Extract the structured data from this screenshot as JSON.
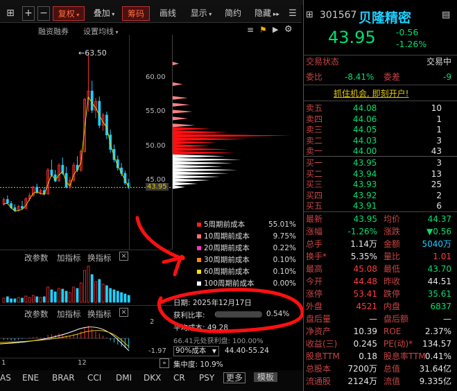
{
  "toolbar": {
    "fuquan": "复权",
    "diejia": "叠加",
    "chouma": "筹码",
    "huaxian": "画线",
    "xianshi": "显示",
    "jianyue": "简约",
    "yincang": "隐藏"
  },
  "chart": {
    "rongzi": "融资融券",
    "set_ma": "设置均线",
    "peak_label": "63.50",
    "y_ticks": [
      "60.00",
      "55.00",
      "50.00",
      "45.00"
    ],
    "current_price": "43.95",
    "panel2_params": "改参数",
    "panel2_add": "加指标",
    "panel2_switch": "换指标",
    "panel3_params": "改参数",
    "panel3_add": "加指标",
    "panel3_switch": "换指标",
    "macd_ticks": [
      "2",
      "-1.97"
    ],
    "x_ticks": [
      "1",
      "12"
    ]
  },
  "chip": {
    "legend": [
      {
        "label": "5周期前成本",
        "value": "55.01%",
        "color": "#ff2020"
      },
      {
        "label": "10周期前成本",
        "value": "9.75%",
        "color": "#ff7070"
      },
      {
        "label": "20周期前成本",
        "value": "0.22%",
        "color": "#ff30c0"
      },
      {
        "label": "30周期前成本",
        "value": "0.10%",
        "color": "#ff8a00"
      },
      {
        "label": "60周期前成本",
        "value": "0.10%",
        "color": "#ffe000"
      },
      {
        "label": "100周期前成本",
        "value": "0.00%",
        "color": "#ffffff"
      }
    ],
    "date_label": "日期: 2025年12月17日",
    "profit_label": "获利比率:",
    "profit_value": "0.54%",
    "profit_ratio": 0.54,
    "avg_cost": "平均成本: 49.28",
    "cost_line": "66.41元处获利盘: 100.00%",
    "cost90_select": "90%成本",
    "cost90_range": "44.40-55.24",
    "concentration": "集中度: 10.9%"
  },
  "bottom_tabs": [
    "AS",
    "ENE",
    "BRAR",
    "CCI",
    "DMI",
    "DKX",
    "CR",
    "PSY",
    "更多",
    "模板"
  ],
  "quote": {
    "code": "301567",
    "name": "贝隆精密",
    "price": "43.95",
    "change": "-0.56",
    "change_pct": "-1.26%",
    "status_label": "交易状态",
    "status_value": "交易中",
    "weibi_label": "委比",
    "weibi_value": "-8.41%",
    "weicha_label": "委差",
    "weicha_value": "-9",
    "banner": "抓住机会, 即刻开户!",
    "asks": [
      {
        "label": "卖五",
        "price": "44.08",
        "vol": "10"
      },
      {
        "label": "卖四",
        "price": "44.06",
        "vol": "1"
      },
      {
        "label": "卖三",
        "price": "44.05",
        "vol": "1"
      },
      {
        "label": "卖二",
        "price": "44.03",
        "vol": "3"
      },
      {
        "label": "卖一",
        "price": "44.00",
        "vol": "43"
      }
    ],
    "bids": [
      {
        "label": "买一",
        "price": "43.95",
        "vol": "3"
      },
      {
        "label": "买二",
        "price": "43.94",
        "vol": "13"
      },
      {
        "label": "买三",
        "price": "43.93",
        "vol": "25"
      },
      {
        "label": "买四",
        "price": "43.92",
        "vol": "2"
      },
      {
        "label": "买五",
        "price": "43.91",
        "vol": "6"
      }
    ],
    "stats": [
      {
        "l1": "最新",
        "v1": "43.95",
        "c1": "grn",
        "l2": "均价",
        "v2": "44.37",
        "c2": "grn"
      },
      {
        "l1": "涨幅",
        "v1": "-1.26%",
        "c1": "grn",
        "l2": "涨跌",
        "v2": "▼0.56",
        "c2": "grn"
      },
      {
        "l1": "总手",
        "v1": "1.14万",
        "c1": "wht",
        "l2": "金额",
        "v2": "5040万",
        "c2": "cyan"
      },
      {
        "l1": "换手*",
        "v1": "5.35%",
        "c1": "wht",
        "l2": "量比",
        "v2": "1.01",
        "c2": "red"
      },
      {
        "l1": "最高",
        "v1": "45.08",
        "c1": "red",
        "l2": "最低",
        "v2": "43.70",
        "c2": "grn"
      },
      {
        "l1": "今开",
        "v1": "44.48",
        "c1": "red",
        "l2": "昨收",
        "v2": "44.51",
        "c2": "wht"
      },
      {
        "l1": "涨停",
        "v1": "53.41",
        "c1": "red",
        "l2": "跌停",
        "v2": "35.61",
        "c2": "grn"
      },
      {
        "l1": "外盘",
        "v1": "4521",
        "c1": "red",
        "l2": "内盘",
        "v2": "6837",
        "c2": "grn"
      },
      {
        "l1": "盘后量",
        "v1": "—",
        "c1": "wht",
        "l2": "盘后额",
        "v2": "—",
        "c2": "wht"
      },
      {
        "l1": "净资产",
        "v1": "10.39",
        "c1": "wht",
        "l2": "ROE",
        "v2": "2.37%",
        "c2": "wht"
      },
      {
        "l1": "收益(三)",
        "v1": "0.245",
        "c1": "wht",
        "l2": "PE(动)*",
        "v2": "134.57",
        "c2": "wht"
      },
      {
        "l1": "股息TTM",
        "v1": "0.18",
        "c1": "wht",
        "l2": "股息率TTM",
        "v2": "0.41%",
        "c2": "wht"
      },
      {
        "l1": "总股本",
        "v1": "7200万",
        "c1": "wht",
        "l2": "总值",
        "v2": "31.64亿",
        "c2": "wht"
      },
      {
        "l1": "流通股",
        "v1": "2124万",
        "c1": "wht",
        "l2": "流值",
        "v2": "9.335亿",
        "c2": "wht"
      }
    ]
  }
}
